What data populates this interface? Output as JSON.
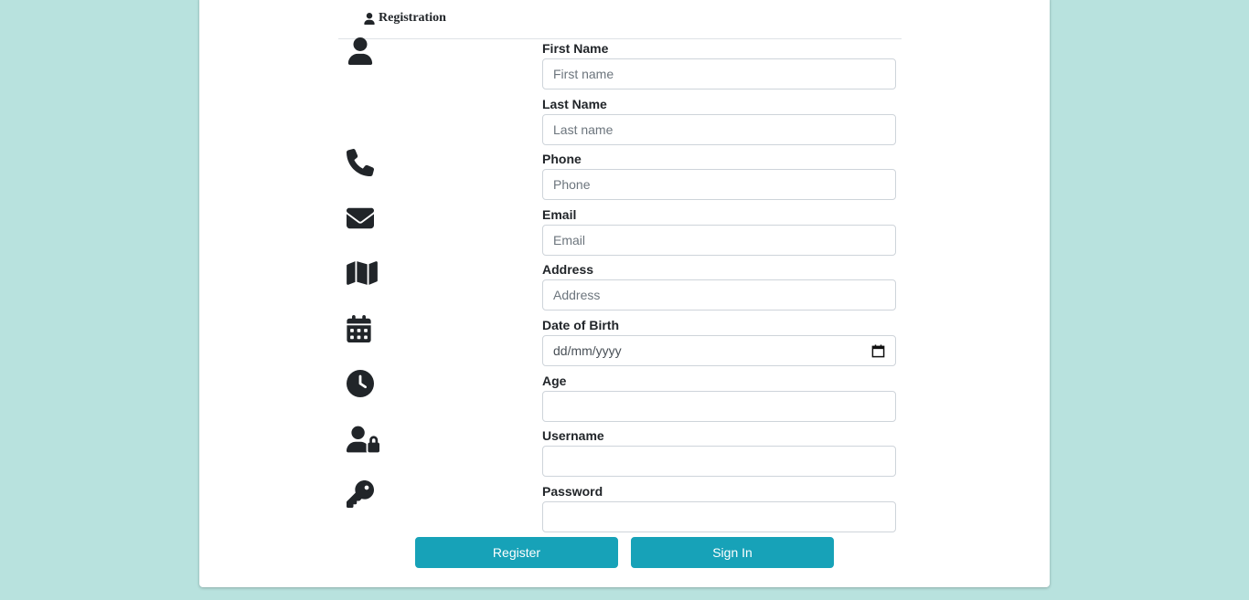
{
  "header": {
    "title": "Registration",
    "icon": "user-icon"
  },
  "fields": [
    {
      "label": "First Name",
      "placeholder": "First name",
      "icon": "user-icon"
    },
    {
      "label": "Last Name",
      "placeholder": "Last name",
      "icon": ""
    },
    {
      "label": "Phone",
      "placeholder": "Phone",
      "icon": "phone-icon"
    },
    {
      "label": "Email",
      "placeholder": "Email",
      "icon": "envelope-icon"
    },
    {
      "label": "Address",
      "placeholder": "Address",
      "icon": "map-icon"
    },
    {
      "label": "Date of Birth",
      "placeholder": "dd/mm/yyyy",
      "icon": "calendar-icon"
    },
    {
      "label": "Age",
      "placeholder": "",
      "icon": "clock-icon"
    },
    {
      "label": "Username",
      "placeholder": "",
      "icon": "user-lock-icon"
    },
    {
      "label": "Password",
      "placeholder": "",
      "icon": "key-icon"
    }
  ],
  "buttons": {
    "register": "Register",
    "sign_in": "Sign In"
  },
  "colors": {
    "background": "#b8e2de",
    "accent": "#17a2b8"
  }
}
